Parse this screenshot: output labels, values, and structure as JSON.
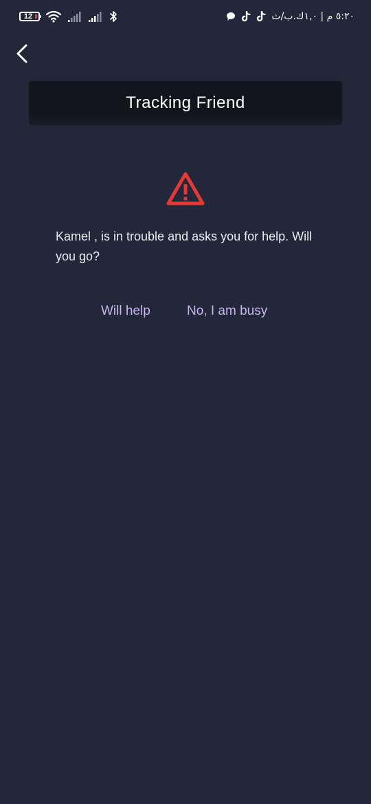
{
  "status_bar": {
    "battery_level": "12",
    "right_text": "٥:٢٠ م | ١,٠ك.ب/ث",
    "icons": [
      "battery-icon",
      "wifi-icon",
      "signal-icon",
      "signal-icon",
      "bluetooth-icon",
      "tiktok-icon",
      "tiktok-icon",
      "chat-bubble-icon"
    ]
  },
  "header": {
    "back_icon": "chevron-left-icon",
    "title": "Tracking Friend"
  },
  "alert": {
    "icon": "warning-triangle-icon",
    "icon_color": "#e53935",
    "message": "Kamel , is in trouble and asks you for help. Will you go?"
  },
  "actions": {
    "accept_label": "Will help",
    "decline_label": "No, I am busy",
    "accent_color": "#c6b5f0"
  },
  "colors": {
    "background": "#222739",
    "title_card": "#13151c"
  }
}
